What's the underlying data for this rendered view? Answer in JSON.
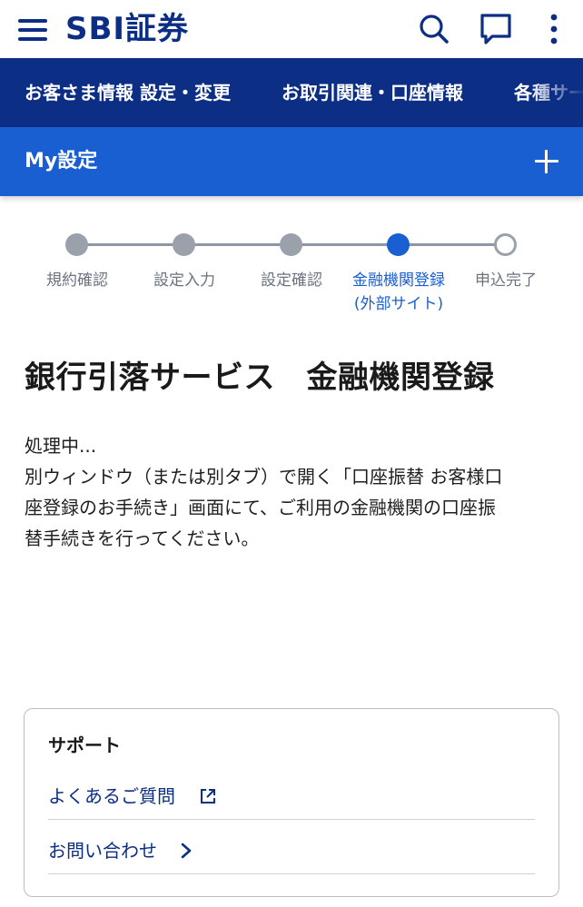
{
  "header": {
    "logo": "SBI証券",
    "icons": [
      "hamburger-menu-icon",
      "search-icon",
      "chat-icon",
      "more-vertical-icon"
    ]
  },
  "nav": {
    "items": [
      {
        "label": "お客さま情報 設定・変更"
      },
      {
        "label": "お取引関連・口座情報"
      },
      {
        "label": "各種サービス"
      }
    ]
  },
  "section": {
    "title": "My設定",
    "expand_icon": "plus-icon"
  },
  "stepper": {
    "steps": [
      {
        "label": "規約確認",
        "label2": "",
        "state": "done"
      },
      {
        "label": "設定入力",
        "label2": "",
        "state": "done"
      },
      {
        "label": "設定確認",
        "label2": "",
        "state": "done"
      },
      {
        "label": "金融機関登録",
        "label2": "(外部サイト)",
        "state": "current"
      },
      {
        "label": "申込完了",
        "label2": "",
        "state": "todo"
      }
    ]
  },
  "main": {
    "title": "銀行引落サービス　金融機関登録",
    "status": "処理中...",
    "line1": "別ウィンドウ（または別タブ）で開く「口座振替 お客様口",
    "line2": "座登録のお手続き」画面にて、ご利用の金融機関の口座振",
    "line3": "替手続きを行ってください。"
  },
  "support": {
    "heading": "サポート",
    "links": [
      {
        "label": "よくあるご質問",
        "icon": "external-link-icon"
      },
      {
        "label": "お問い合わせ",
        "icon": "chevron-right-icon"
      }
    ]
  },
  "colors": {
    "brand_navy": "#0c2e85",
    "accent_blue": "#1a5fd1",
    "step_gray": "#9aa1ab"
  }
}
